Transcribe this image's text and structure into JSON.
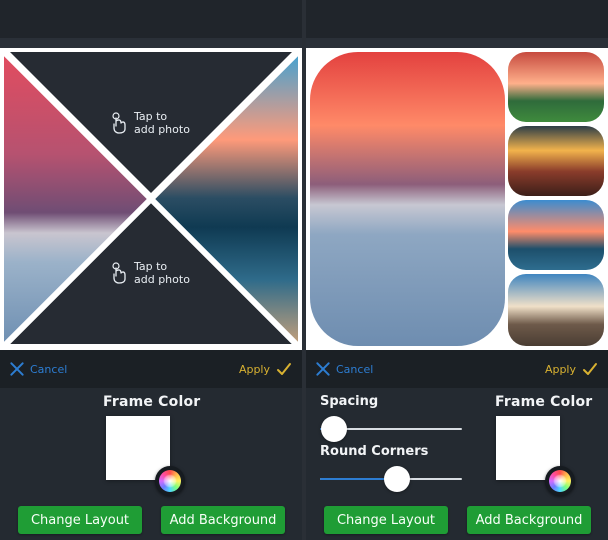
{
  "left": {
    "tap_to_add": {
      "line1": "Tap to",
      "line2": "add photo"
    },
    "actions": {
      "cancel": "Cancel",
      "apply": "Apply"
    },
    "frame_color_title": "Frame Color",
    "buttons": {
      "change_layout": "Change Layout",
      "add_background": "Add Background"
    }
  },
  "right": {
    "actions": {
      "cancel": "Cancel",
      "apply": "Apply"
    },
    "spacing_label": "Spacing",
    "round_corners_label": "Round Corners",
    "frame_color_title": "Frame Color",
    "sliders": {
      "spacing_value": 0.1,
      "round_corners_value": 0.54
    },
    "buttons": {
      "change_layout": "Change Layout",
      "add_background": "Add Background"
    }
  },
  "colors": {
    "accent_blue": "#2d7dd2",
    "accent_green": "#1f9d35",
    "accent_gold": "#d8b131",
    "frame_white": "#ffffff"
  },
  "icons": [
    "x-icon",
    "checkmark-icon",
    "hand-tap-icon",
    "color-wheel-icon"
  ]
}
